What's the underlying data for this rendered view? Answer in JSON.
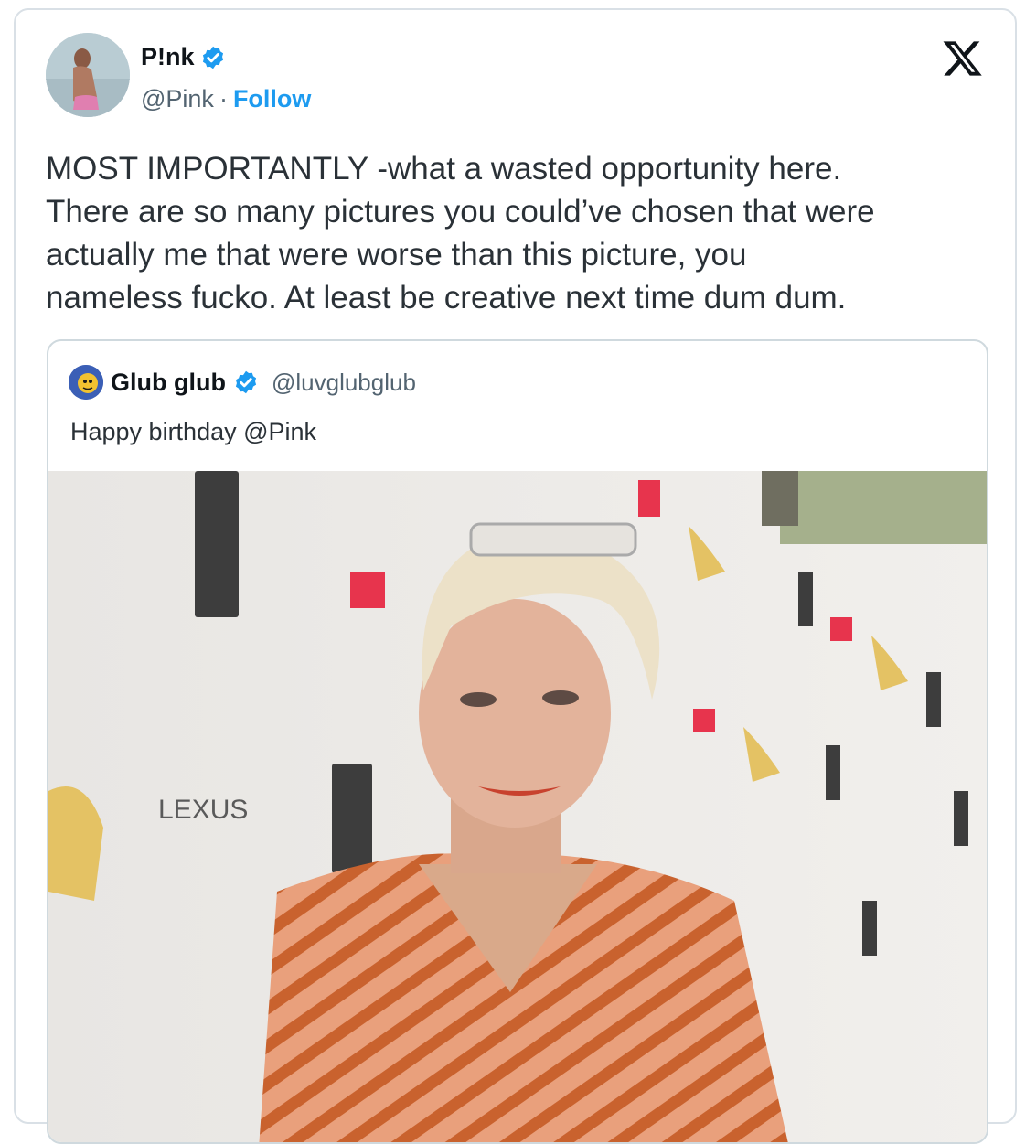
{
  "tweet": {
    "author_name": "P!nk",
    "handle": "@Pink",
    "separator": "·",
    "follow_label": "Follow",
    "text": "MOST IMPORTANTLY -what a wasted opportunity here.\nThere are so many pictures you could’ve chosen that were\nactually me that were worse than this picture, you\nnameless fucko. At least be creative next time dum dum."
  },
  "quoted": {
    "author_name": "Glub glub",
    "handle": "@luvglubglub",
    "text": "Happy birthday @Pink"
  },
  "icons": {
    "verified": "verified-badge-icon",
    "close": "x-logo-icon"
  },
  "colors": {
    "accent": "#1d9bf0",
    "text": "#0f1419",
    "muted": "#536471",
    "border": "#d9e0e6"
  }
}
